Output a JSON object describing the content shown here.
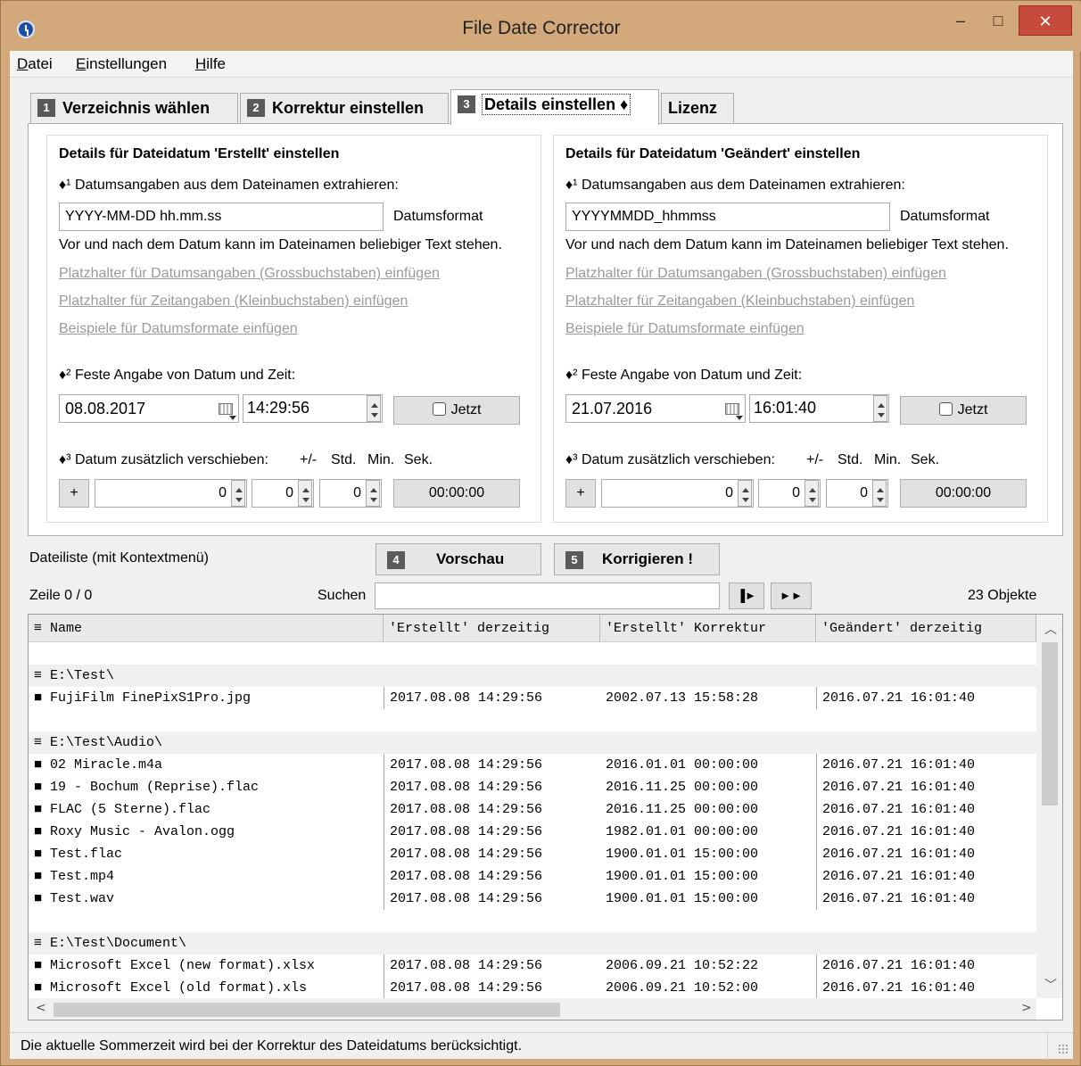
{
  "window": {
    "title": "File Date Corrector",
    "min": "–",
    "max": "□",
    "close": "✕"
  },
  "menu": {
    "datei_u": "D",
    "datei_rest": "atei",
    "einst_u": "E",
    "einst_rest": "instellungen",
    "hilfe_u": "H",
    "hilfe_rest": "ilfe"
  },
  "tabs": [
    {
      "num": "1",
      "label": "Verzeichnis wählen"
    },
    {
      "num": "2",
      "label": "Korrektur einstellen"
    },
    {
      "num": "3",
      "label": "Details einstellen ♦"
    },
    {
      "label": "Lizenz"
    }
  ],
  "left": {
    "title": "Details für Dateidatum 'Erstellt' einstellen",
    "extract_label": "♦¹ Datumsangaben aus dem Dateinamen extrahieren:",
    "format_value": "YYYY-MM-DD hh.mm.ss",
    "format_label": "Datumsformat",
    "hint": "Vor und nach dem Datum kann im Dateinamen beliebiger Text stehen.",
    "link1": "Platzhalter für Datumsangaben (Grossbuchstaben) einfügen",
    "link2": "Platzhalter für Zeitangaben (Kleinbuchstaben) einfügen",
    "link3": "Beispiele für Datumsformate einfügen",
    "fixed_label": "♦² Feste Angabe von Datum und Zeit:",
    "date": "08.08.2017",
    "time": "14:29:56",
    "now_label": "Jetzt",
    "shift_label": "♦³ Datum zusätzlich verschieben:",
    "pm": "+/-",
    "std": "Std.",
    "min": "Min.",
    "sek": "Sek.",
    "sign": "+",
    "hours": "0",
    "minutes": "0",
    "seconds": "0",
    "result": "00:00:00"
  },
  "right": {
    "title": "Details für Dateidatum 'Geändert' einstellen",
    "extract_label": "♦¹ Datumsangaben aus dem Dateinamen extrahieren:",
    "format_value": "YYYYMMDD_hhmmss",
    "format_label": "Datumsformat",
    "hint": "Vor und nach dem Datum kann im Dateinamen beliebiger Text stehen.",
    "link1": "Platzhalter für Datumsangaben (Grossbuchstaben) einfügen",
    "link2": "Platzhalter für Zeitangaben (Kleinbuchstaben) einfügen",
    "link3": "Beispiele für Datumsformate einfügen",
    "fixed_label": "♦² Feste Angabe von Datum und Zeit:",
    "date": "21.07.2016",
    "time": "16:01:40",
    "now_label": "Jetzt",
    "shift_label": "♦³ Datum zusätzlich verschieben:",
    "pm": "+/-",
    "std": "Std.",
    "min": "Min.",
    "sek": "Sek.",
    "sign": "+",
    "hours": "0",
    "minutes": "0",
    "seconds": "0",
    "result": "00:00:00"
  },
  "filelist": {
    "label": "Dateiliste (mit Kontextmenü)",
    "preview_num": "4",
    "preview": "Vorschau",
    "correct_num": "5",
    "correct": "Korrigieren !",
    "row_info": "Zeile 0 / 0",
    "search_label": "Suchen",
    "search_value": "",
    "next": "▐►",
    "fast": "►►",
    "count": "23 Objekte",
    "columns": [
      "≡ Name",
      "'Erstellt' derzeitig",
      "'Erstellt' Korrektur",
      "'Geändert' derzeitig"
    ],
    "rows": [
      {
        "type": "blank"
      },
      {
        "type": "group",
        "name": "≡ E:\\Test\\"
      },
      {
        "type": "file",
        "name": "■ FujiFilm FinePixS1Pro.jpg",
        "c2": "2017.08.08 14:29:56",
        "c3": "2002.07.13 15:58:28",
        "c4": "2016.07.21 16:01:40"
      },
      {
        "type": "blank"
      },
      {
        "type": "group",
        "name": "≡ E:\\Test\\Audio\\"
      },
      {
        "type": "file",
        "name": "■ 02 Miracle.m4a",
        "c2": "2017.08.08 14:29:56",
        "c3": "2016.01.01 00:00:00",
        "c4": "2016.07.21 16:01:40"
      },
      {
        "type": "file",
        "name": "■ 19 - Bochum (Reprise).flac",
        "c2": "2017.08.08 14:29:56",
        "c3": "2016.11.25 00:00:00",
        "c4": "2016.07.21 16:01:40"
      },
      {
        "type": "file",
        "name": "■ FLAC (5 Sterne).flac",
        "c2": "2017.08.08 14:29:56",
        "c3": "2016.11.25 00:00:00",
        "c4": "2016.07.21 16:01:40"
      },
      {
        "type": "file",
        "name": "■ Roxy Music - Avalon.ogg",
        "c2": "2017.08.08 14:29:56",
        "c3": "1982.01.01 00:00:00",
        "c4": "2016.07.21 16:01:40"
      },
      {
        "type": "file",
        "name": "■ Test.flac",
        "c2": "2017.08.08 14:29:56",
        "c3": "1900.01.01 15:00:00",
        "c4": "2016.07.21 16:01:40"
      },
      {
        "type": "file",
        "name": "■ Test.mp4",
        "c2": "2017.08.08 14:29:56",
        "c3": "1900.01.01 15:00:00",
        "c4": "2016.07.21 16:01:40"
      },
      {
        "type": "file",
        "name": "■ Test.wav",
        "c2": "2017.08.08 14:29:56",
        "c3": "1900.01.01 15:00:00",
        "c4": "2016.07.21 16:01:40"
      },
      {
        "type": "blank"
      },
      {
        "type": "group",
        "name": "≡ E:\\Test\\Document\\"
      },
      {
        "type": "file",
        "name": "■ Microsoft Excel (new format).xlsx",
        "c2": "2017.08.08 14:29:56",
        "c3": "2006.09.21 10:52:22",
        "c4": "2016.07.21 16:01:40"
      },
      {
        "type": "file",
        "name": "■ Microsoft Excel (old format).xls",
        "c2": "2017.08.08 14:29:56",
        "c3": "2006.09.21 10:52:00",
        "c4": "2016.07.21 16:01:40"
      }
    ]
  },
  "status": "Die aktuelle Sommerzeit wird bei der Korrektur des Dateidatums berücksichtigt."
}
